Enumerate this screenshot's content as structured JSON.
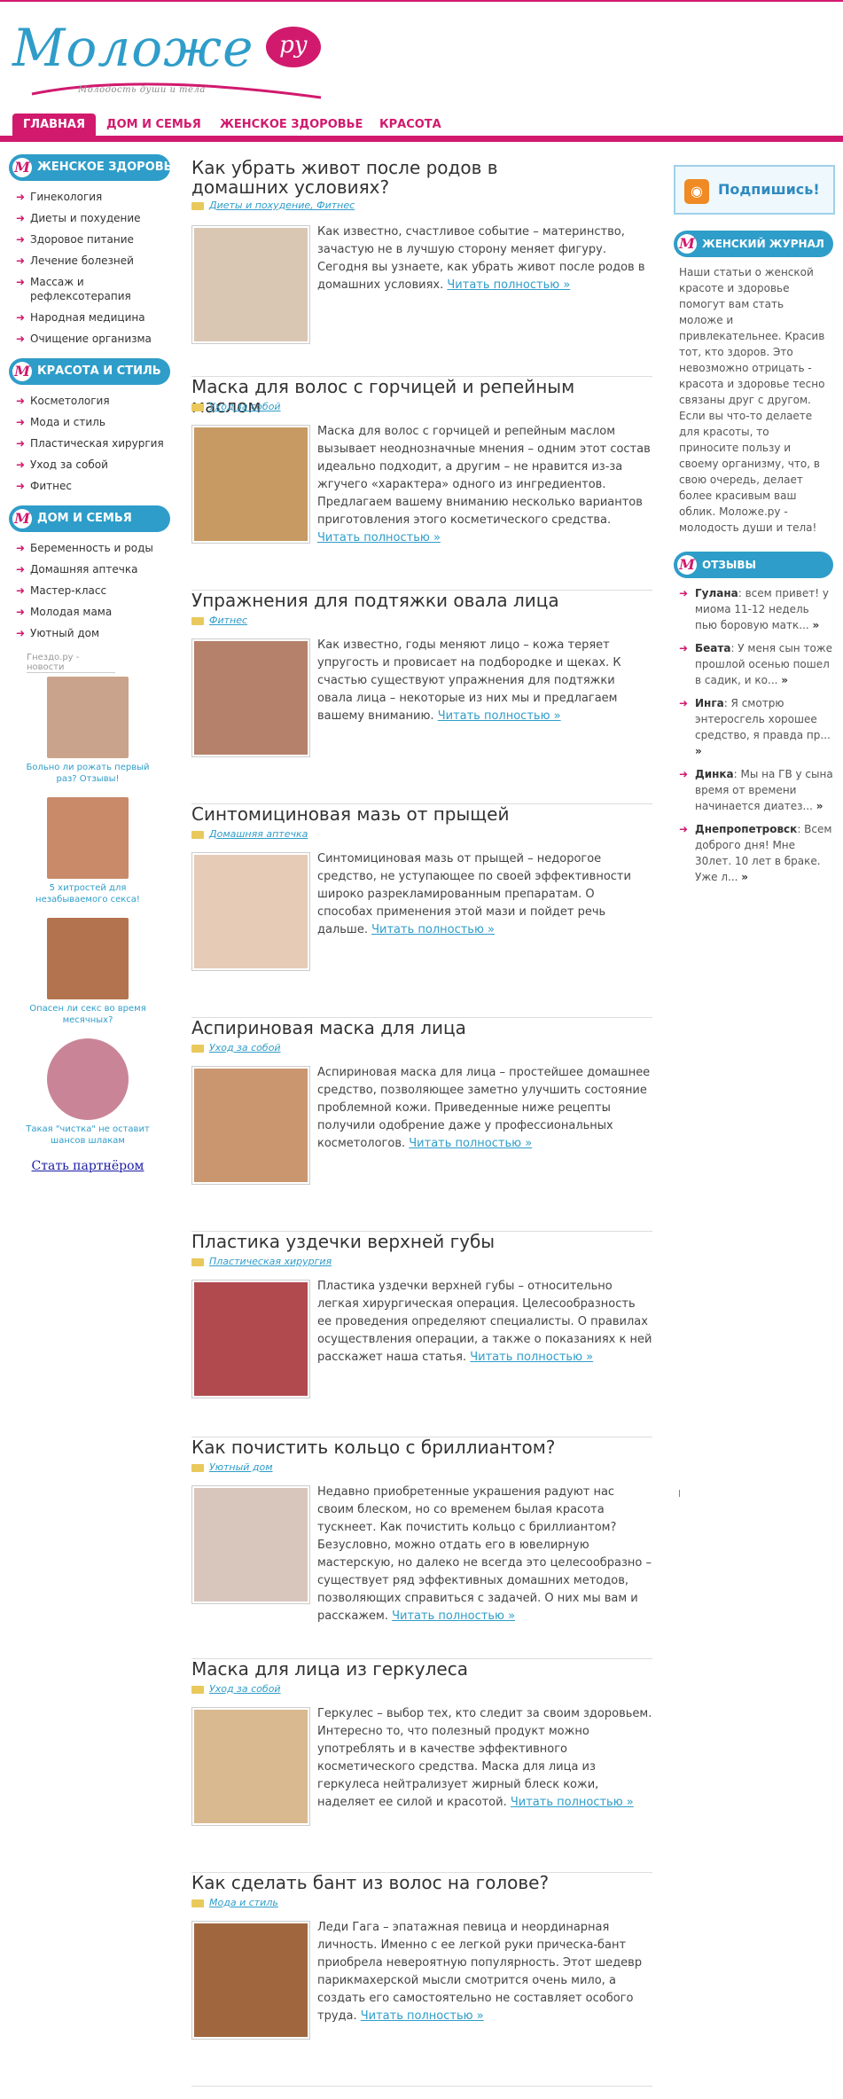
{
  "site": {
    "logo_text": "Моложе",
    "logo_badge": "ру",
    "tagline": "Молодость души и тела"
  },
  "colors": {
    "brand_pink": "#d11a6e",
    "brand_blue": "#2f9dc9",
    "link": "#2f9dc9"
  },
  "nav": {
    "items": [
      "ГЛАВНАЯ",
      "ДОМ И СЕМЬЯ",
      "ЖЕНСКОЕ ЗДОРОВЬЕ",
      "КРАСОТА"
    ],
    "active": "ГЛАВНАЯ"
  },
  "left": {
    "sections": [
      {
        "title": "ЖЕНСКОЕ ЗДОРОВЬЕ",
        "items": [
          "Гинекология",
          "Диеты и похудение",
          "Здоровое питание",
          "Лечение болезней",
          "Массаж и рефлексотерапия",
          "Народная медицина",
          "Очищение организма"
        ]
      },
      {
        "title": "КРАСОТА И СТИЛЬ",
        "items": [
          "Косметология",
          "Мода и стиль",
          "Пластическая хирургия",
          "Уход за собой",
          "Фитнес"
        ]
      },
      {
        "title": "ДОМ И СЕМЬЯ",
        "items": [
          "Беременность и роды",
          "Домашняя аптечка",
          "Мастер-класс",
          "Молодая мама",
          "Уютный дом"
        ]
      }
    ],
    "partner_note": "Гнездо.ру - новости",
    "promos": [
      {
        "caption": "Больно ли рожать первый раз? Отзывы!",
        "color": "#caa38c"
      },
      {
        "caption": "5 хитростей для незабываемого секса!",
        "color": "#c98a6a"
      },
      {
        "caption": "Опасен ли секс во время месячных?",
        "color": "#b3734f"
      },
      {
        "caption": "Такая \"чистка\" не оставит шансов шлакам",
        "color": "#c98597"
      }
    ],
    "partner_link": "Стать партнёром"
  },
  "articles": [
    {
      "title": "Как убрать живот после родов в домашних условиях?",
      "categories": "Диеты и похудение, Фитнес",
      "text": "Как известно, счастливое событие – материнство, зачастую не в лучшую сторону меняет фигуру. Сегодня вы узнаете, как убрать живот после родов в домашних условиях.",
      "more": "Читать полностью »",
      "thumb_color": "#d9c7b4"
    },
    {
      "title": "Маска для волос с горчицей и репейным маслом",
      "categories": "Уход за собой",
      "text": "Маска для волос с горчицей и репейным маслом вызывает неоднозначные мнения – одним этот состав идеально подходит, а другим – не нравится из-за жгучего «характера» одного из ингредиентов. Предлагаем вашему вниманию несколько вариантов приготовления этого косметического средства.",
      "more": "Читать полностью »",
      "thumb_color": "#c79a63"
    },
    {
      "title": "Упражнения для подтяжки овала лица",
      "categories": "Фитнес",
      "text": "Как известно, годы меняют лицо – кожа теряет упругость и провисает на подбородке и щеках. К счастью существуют упражнения для подтяжки овала лица – некоторые из них мы и предлагаем вашему вниманию.",
      "more": "Читать полностью »",
      "thumb_color": "#b5816a"
    },
    {
      "title": "Синтомициновая мазь от прыщей",
      "categories": "Домашняя аптечка",
      "text": "Синтомициновая мазь от прыщей – недорогое средство, не уступающее по своей эффективности широко разрекламированным препаратам. О способах применения этой мази и пойдет речь дальше.",
      "more": "Читать полностью »",
      "thumb_color": "#e6cbb7"
    },
    {
      "title": "Аспириновая маска для лица",
      "categories": "Уход за собой",
      "text": "Аспириновая маска для лица – простейшее домашнее средство, позволяющее заметно улучшить состояние проблемной кожи. Приведенные ниже рецепты получили одобрение даже у профессиональных косметологов.",
      "more": "Читать полностью »",
      "thumb_color": "#c9966f"
    },
    {
      "title": "Пластика уздечки верхней губы",
      "categories": "Пластическая хирургия",
      "text": "Пластика уздечки верхней губы – относительно легкая хирургическая операция. Целесообразность ее проведения определяют специалисты. О правилах осуществления операции, а также о показаниях к ней расскажет наша статья.",
      "more": "Читать полностью »",
      "thumb_color": "#b04a4f"
    },
    {
      "title": "Как почистить кольцо с бриллиантом?",
      "categories": "Уютный дом",
      "text": "Недавно приобретенные украшения радуют нас своим блеском, но со временем былая красота тускнеет. Как почистить кольцо с бриллиантом? Безусловно, можно отдать его в ювелирную мастерскую, но далеко не всегда это целесообразно – существует ряд эффективных домашних методов, позволяющих справиться с задачей. О них мы вам и расскажем.",
      "more": "Читать полностью »",
      "thumb_color": "#d8c6bd"
    },
    {
      "title": "Маска для лица из геркулеса",
      "categories": "Уход за собой",
      "text": "Геркулес – выбор тех, кто следит за своим здоровьем. Интересно то, что полезный продукт можно употреблять и в качестве эффективного косметического средства. Маска для лица из геркулеса нейтрализует жирный блеск кожи, наделяет ее силой и красотой.",
      "more": "Читать полностью »",
      "thumb_color": "#d9b98f"
    },
    {
      "title": "Как сделать бант из волос на голове?",
      "categories": "Мода и стиль",
      "text": "Леди Гага – эпатажная певица и неординарная личность. Именно с ее легкой руки прическа-бант приобрела невероятную популярность. Этот шедевр парикмахерской мысли смотрится очень мило, а создать его самостоятельно не составляет особого труда.",
      "more": "Читать полностью »",
      "thumb_color": "#a0673f"
    }
  ],
  "right": {
    "subscribe": "Подпишись!",
    "magazine_title": "ЖЕНСКИЙ ЖУРНАЛ",
    "magazine_text": "Наши статьи о женской красоте и здоровье помогут вам стать моложе и привлекательнее. Красив тот, кто здоров. Это невозможно отрицать - красота и здоровье тесно связаны друг с другом. Если вы что-то делаете для красоты, то приносите пользу и своему организму, что, в свою очередь, делает более красивым ваш облик. Моложе.ру - молодость души и тела!",
    "reviews_title": "ОТЗЫВЫ",
    "reviews": [
      {
        "author": "Гулана",
        "text": ": всем привет! у миома 11-12 недель пью боровую матк...",
        "more": "»"
      },
      {
        "author": "Беата",
        "text": ": У меня сын тоже прошлой осенью пошел в садик, и ко...",
        "more": "»"
      },
      {
        "author": "Инга",
        "text": ": Я смотрю энтеросгель хорошее средство, я правда пр...",
        "more": "»"
      },
      {
        "author": "Динка",
        "text": ": Мы на ГВ у сына время от времени начинается диатез...",
        "more": "»"
      },
      {
        "author": "Днепропетровск",
        "text": ": Всем доброго дня! Мне 30лет. 10 лет в браке. Уже л...",
        "more": "»"
      }
    ]
  }
}
